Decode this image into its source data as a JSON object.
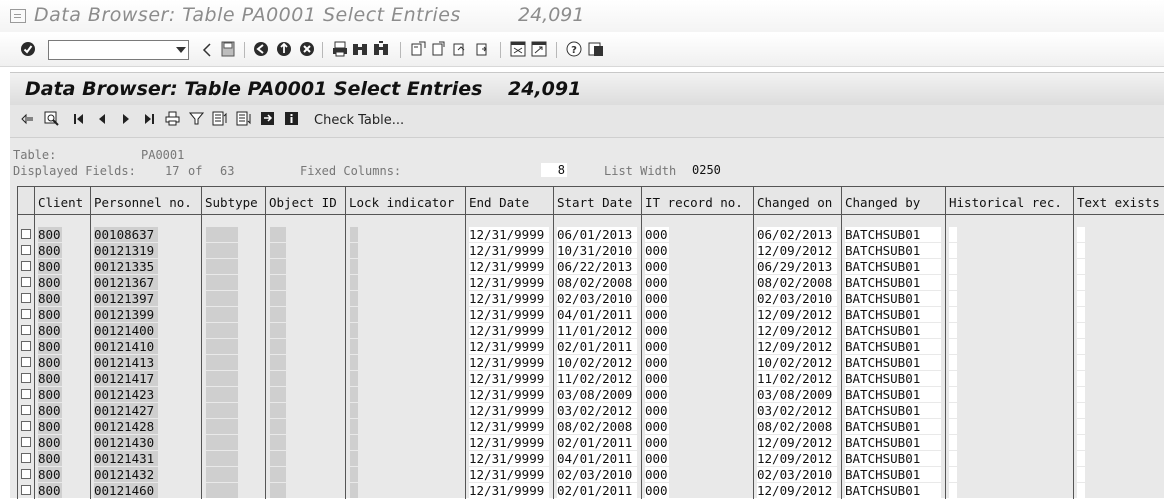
{
  "window": {
    "title": "Data Browser: Table PA0001 Select Entries",
    "count": "24,091"
  },
  "std_toolbar": {
    "command_field": {
      "value": "",
      "placeholder": ""
    },
    "icons": [
      "enter-icon",
      "back-icon",
      "save-icon",
      "exit-icon",
      "cancel-icon",
      "stop-icon",
      "print-icon",
      "find-icon",
      "find-next-icon",
      "first-page-icon",
      "previous-page-icon",
      "next-page-icon",
      "last-page-icon",
      "create-session-icon",
      "shortcut-icon",
      "help-icon",
      "layout-icon"
    ]
  },
  "page": {
    "title": "Data Browser: Table PA0001 Select Entries",
    "count": "24,091"
  },
  "app_toolbar": {
    "check_table_label": "Check Table..."
  },
  "info": {
    "table_label": "Table:",
    "table_value": "PA0001",
    "displayed_fields_label": "Displayed Fields:",
    "displayed_fields_value": "17",
    "of_label": "of",
    "total_fields_value": "63",
    "fixed_columns_label": "Fixed Columns:",
    "fixed_columns_value": "8",
    "list_width_label": "List Width",
    "list_width_value": "0250"
  },
  "table": {
    "columns": [
      "Client",
      "Personnel no.",
      "Subtype",
      "Object ID",
      "Lock indicator",
      "End Date",
      "Start Date",
      "IT record no.",
      "Changed on",
      "Changed by",
      "Historical rec.",
      "Text exists"
    ],
    "rows": [
      {
        "client": "800",
        "pernr": "00108637",
        "end": "12/31/9999",
        "start": "06/01/2013",
        "it": "000",
        "changed_on": "06/02/2013",
        "changed_by": "BATCHSUB01"
      },
      {
        "client": "800",
        "pernr": "00121319",
        "end": "12/31/9999",
        "start": "10/31/2010",
        "it": "000",
        "changed_on": "12/09/2012",
        "changed_by": "BATCHSUB01"
      },
      {
        "client": "800",
        "pernr": "00121335",
        "end": "12/31/9999",
        "start": "06/22/2013",
        "it": "000",
        "changed_on": "06/29/2013",
        "changed_by": "BATCHSUB01"
      },
      {
        "client": "800",
        "pernr": "00121367",
        "end": "12/31/9999",
        "start": "08/02/2008",
        "it": "000",
        "changed_on": "08/02/2008",
        "changed_by": "BATCHSUB01"
      },
      {
        "client": "800",
        "pernr": "00121397",
        "end": "12/31/9999",
        "start": "02/03/2010",
        "it": "000",
        "changed_on": "02/03/2010",
        "changed_by": "BATCHSUB01"
      },
      {
        "client": "800",
        "pernr": "00121399",
        "end": "12/31/9999",
        "start": "04/01/2011",
        "it": "000",
        "changed_on": "12/09/2012",
        "changed_by": "BATCHSUB01"
      },
      {
        "client": "800",
        "pernr": "00121400",
        "end": "12/31/9999",
        "start": "11/01/2012",
        "it": "000",
        "changed_on": "12/09/2012",
        "changed_by": "BATCHSUB01"
      },
      {
        "client": "800",
        "pernr": "00121410",
        "end": "12/31/9999",
        "start": "02/01/2011",
        "it": "000",
        "changed_on": "12/09/2012",
        "changed_by": "BATCHSUB01"
      },
      {
        "client": "800",
        "pernr": "00121413",
        "end": "12/31/9999",
        "start": "10/02/2012",
        "it": "000",
        "changed_on": "10/02/2012",
        "changed_by": "BATCHSUB01"
      },
      {
        "client": "800",
        "pernr": "00121417",
        "end": "12/31/9999",
        "start": "11/02/2012",
        "it": "000",
        "changed_on": "11/02/2012",
        "changed_by": "BATCHSUB01"
      },
      {
        "client": "800",
        "pernr": "00121423",
        "end": "12/31/9999",
        "start": "03/08/2009",
        "it": "000",
        "changed_on": "03/08/2009",
        "changed_by": "BATCHSUB01"
      },
      {
        "client": "800",
        "pernr": "00121427",
        "end": "12/31/9999",
        "start": "03/02/2012",
        "it": "000",
        "changed_on": "03/02/2012",
        "changed_by": "BATCHSUB01"
      },
      {
        "client": "800",
        "pernr": "00121428",
        "end": "12/31/9999",
        "start": "08/02/2008",
        "it": "000",
        "changed_on": "08/02/2008",
        "changed_by": "BATCHSUB01"
      },
      {
        "client": "800",
        "pernr": "00121430",
        "end": "12/31/9999",
        "start": "02/01/2011",
        "it": "000",
        "changed_on": "12/09/2012",
        "changed_by": "BATCHSUB01"
      },
      {
        "client": "800",
        "pernr": "00121431",
        "end": "12/31/9999",
        "start": "04/01/2011",
        "it": "000",
        "changed_on": "12/09/2012",
        "changed_by": "BATCHSUB01"
      },
      {
        "client": "800",
        "pernr": "00121432",
        "end": "12/31/9999",
        "start": "02/03/2010",
        "it": "000",
        "changed_on": "02/03/2010",
        "changed_by": "BATCHSUB01"
      },
      {
        "client": "800",
        "pernr": "00121460",
        "end": "12/31/9999",
        "start": "02/01/2011",
        "it": "000",
        "changed_on": "12/09/2012",
        "changed_by": "BATCHSUB01"
      }
    ]
  }
}
